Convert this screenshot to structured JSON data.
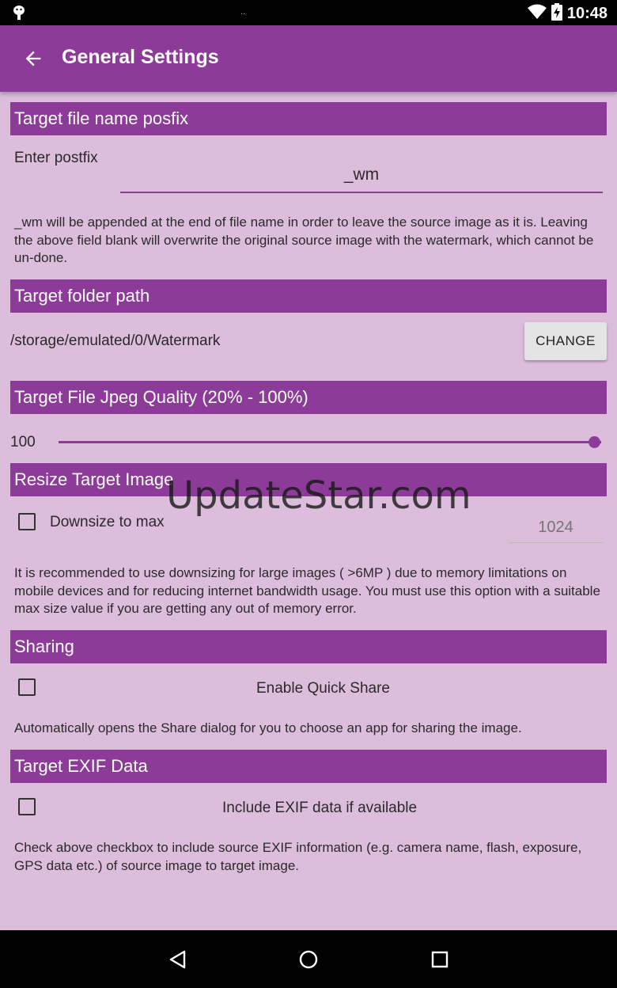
{
  "status_bar": {
    "time": "10:48",
    "notification_dots": ".."
  },
  "app_bar": {
    "title": "General Settings"
  },
  "sections": {
    "postfix": {
      "header": "Target file name posfix",
      "label": "Enter postfix",
      "value": "_wm",
      "description": "_wm will be appended at the end of file name in order to leave the source image as it is. Leaving the above field blank will overwrite the original source image with the watermark, which cannot be un-done."
    },
    "folder": {
      "header": "Target folder path",
      "path": "/storage/emulated/0/Watermark",
      "change_label": "CHANGE"
    },
    "quality": {
      "header": "Target File Jpeg Quality (20% - 100%)",
      "value_text": "100",
      "value": 100,
      "min": 20,
      "max": 100
    },
    "resize": {
      "header": "Resize Target Image",
      "checkbox_label": "Downsize to max",
      "max_placeholder": "1024",
      "checked": false,
      "description": "It is recommended to use downsizing for large images ( >6MP ) due to memory limitations on mobile devices and for reducing internet bandwidth usage. You must use this option with a suitable max size value if you are getting any out of memory error."
    },
    "sharing": {
      "header": "Sharing",
      "checkbox_label": "Enable Quick Share",
      "checked": false,
      "description": "Automatically opens the Share dialog for you to choose an app for sharing the image."
    },
    "exif": {
      "header": "Target EXIF Data",
      "checkbox_label": "Include EXIF data if available",
      "checked": false,
      "description": "Check above checkbox to include source EXIF information (e.g. camera name, flash, exposure, GPS data etc.) of source image to target image."
    }
  },
  "watermark_text": "UpdateStar.com",
  "colors": {
    "accent": "#8c3c98",
    "background": "#dcbedc"
  },
  "icons": {
    "back": "arrow-back-icon",
    "nav_back": "triangle-back-icon",
    "nav_home": "circle-home-icon",
    "nav_recents": "square-recents-icon"
  }
}
